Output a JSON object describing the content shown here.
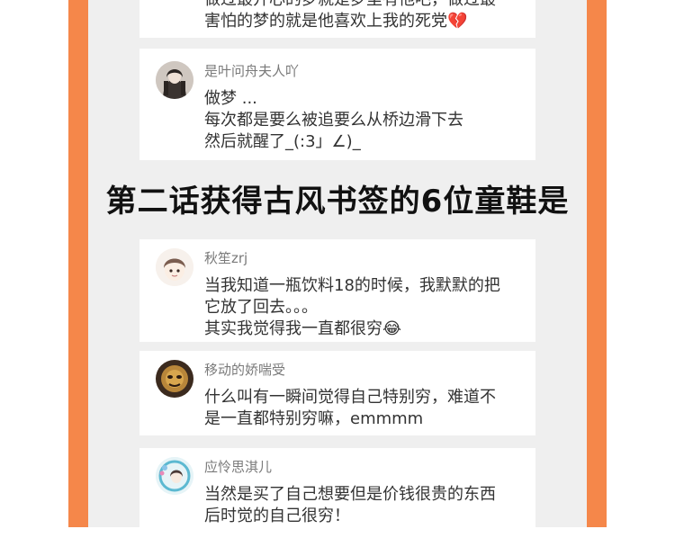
{
  "colors": {
    "stripe": "#f5874a",
    "panel": "#efefef",
    "card": "#ffffff"
  },
  "comments_top": [
    {
      "id": "c0",
      "username": "",
      "lines": [
        "做过最开心的梦就是梦里有他吧，做过最",
        "害怕的梦的就是他喜欢上我的死党"
      ],
      "emoji": "💔"
    },
    {
      "id": "c1",
      "username": "是叶问舟夫人吖",
      "lines": [
        "做梦 ...",
        "每次都是要么被追要么从桥边滑下去",
        "然后就醒了_(:3」∠)_"
      ]
    }
  ],
  "headline": "第二话获得古风书签的6位童鞋是",
  "comments_bottom": [
    {
      "id": "c2",
      "username": "秋笙zrj",
      "lines": [
        "当我知道一瓶饮料18的时候，我默默的把",
        "它放了回去。。。",
        "其实我觉得我一直都很穷"
      ],
      "emoji": "😂"
    },
    {
      "id": "c3",
      "username": "移动的娇喘受",
      "lines": [
        "什么叫有一瞬间觉得自己特别穷，难道不",
        "是一直都特别穷嘛，emmmm"
      ]
    },
    {
      "id": "c4",
      "username": "应怜思淇儿",
      "lines": [
        "当然是买了自己想要但是价钱很贵的东西",
        "后时觉的自己很穷！"
      ]
    }
  ]
}
